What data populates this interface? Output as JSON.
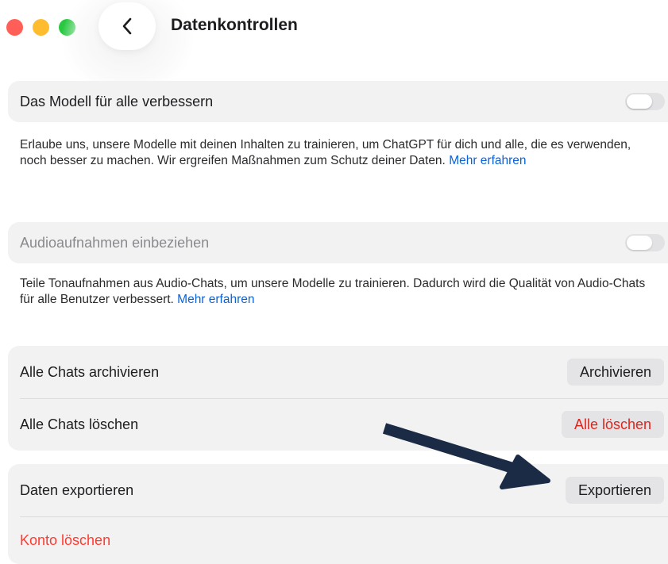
{
  "window": {
    "title": "Datenkontrollen"
  },
  "settings": {
    "improve_model": {
      "label": "Das Modell für alle verbessern",
      "enabled": false,
      "description": "Erlaube uns, unsere Modelle mit deinen Inhalten zu trainieren, um ChatGPT für dich und alle, die es verwenden, noch besser zu machen. Wir ergreifen Maßnahmen zum Schutz deiner Daten.",
      "learn_more": "Mehr erfahren"
    },
    "audio": {
      "label": "Audioaufnahmen einbeziehen",
      "enabled": false,
      "description": "Teile Tonaufnahmen aus Audio-Chats, um unsere Modelle zu trainieren. Dadurch wird die Qualität von Audio-Chats für alle Benutzer verbessert.",
      "learn_more": "Mehr erfahren"
    }
  },
  "chats": {
    "archive_label": "Alle Chats archivieren",
    "archive_button": "Archivieren",
    "delete_label": "Alle Chats löschen",
    "delete_button": "Alle löschen"
  },
  "account": {
    "export_label": "Daten exportieren",
    "export_button": "Exportieren",
    "delete_account": "Konto löschen"
  },
  "colors": {
    "link": "#0a63d8",
    "danger": "#ff3b30",
    "card_background": "#f2f2f3",
    "annotation_arrow": "#1c2b45"
  }
}
